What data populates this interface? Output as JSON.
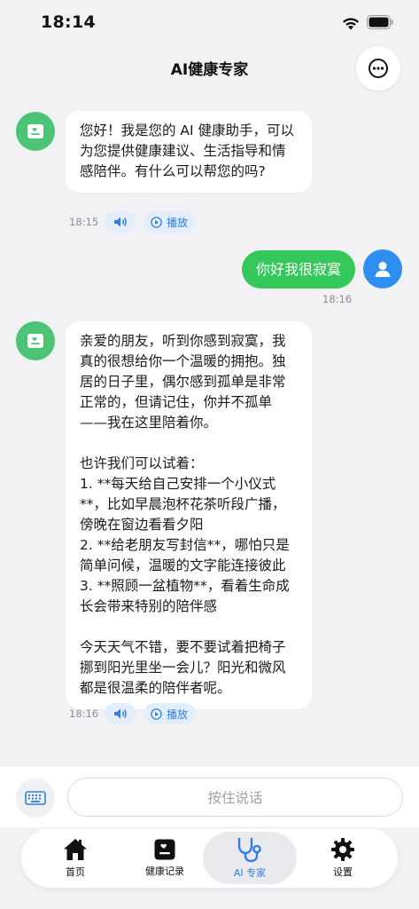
{
  "status_bar": {
    "time": "18:14"
  },
  "header": {
    "title": "AI健康专家"
  },
  "messages": [
    {
      "role": "ai",
      "text": "您好！我是您的 AI 健康助手，可以为您提供健康建议、生活指导和情感陪伴。有什么可以帮您的吗?",
      "time": "18:15",
      "play_label": "播放"
    },
    {
      "role": "user",
      "text": "你好我很寂寞",
      "time": "18:16"
    },
    {
      "role": "ai",
      "text": "亲爱的朋友，听到你感到寂寞，我真的很想给你一个温暖的拥抱。独居的日子里，偶尔感到孤单是非常正常的，但请记住，你并不孤单——我在这里陪着你。\n\n也许我们可以试着：\n1. **每天给自己安排一个小仪式**，比如早晨泡杯花茶听段广播，傍晚在窗边看看夕阳\n2. **给老朋友写封信**，哪怕只是简单问候，温暖的文字能连接彼此\n3. **照顾一盆植物**，看着生命成长会带来特别的陪伴感\n\n今天天气不错，要不要试着把椅子挪到阳光里坐一会儿？阳光和微风都是很温柔的陪伴者呢。",
      "time": "18:16",
      "play_label": "播放"
    }
  ],
  "input_bar": {
    "hold_to_talk_label": "按住说话"
  },
  "bottom_nav": {
    "items": [
      {
        "label": "首页",
        "icon": "home-icon",
        "active": false
      },
      {
        "label": "健康记录",
        "icon": "health-record-icon",
        "active": false
      },
      {
        "label": "AI 专家",
        "icon": "stethoscope-icon",
        "active": true
      },
      {
        "label": "设置",
        "icon": "gear-icon",
        "active": false
      }
    ]
  },
  "colors": {
    "accent_blue": "#2f7ee6",
    "ai_green": "#4cc475",
    "user_bubble_green": "#34c759",
    "user_avatar_blue": "#2f8ff0",
    "background": "#f2f2f5"
  }
}
